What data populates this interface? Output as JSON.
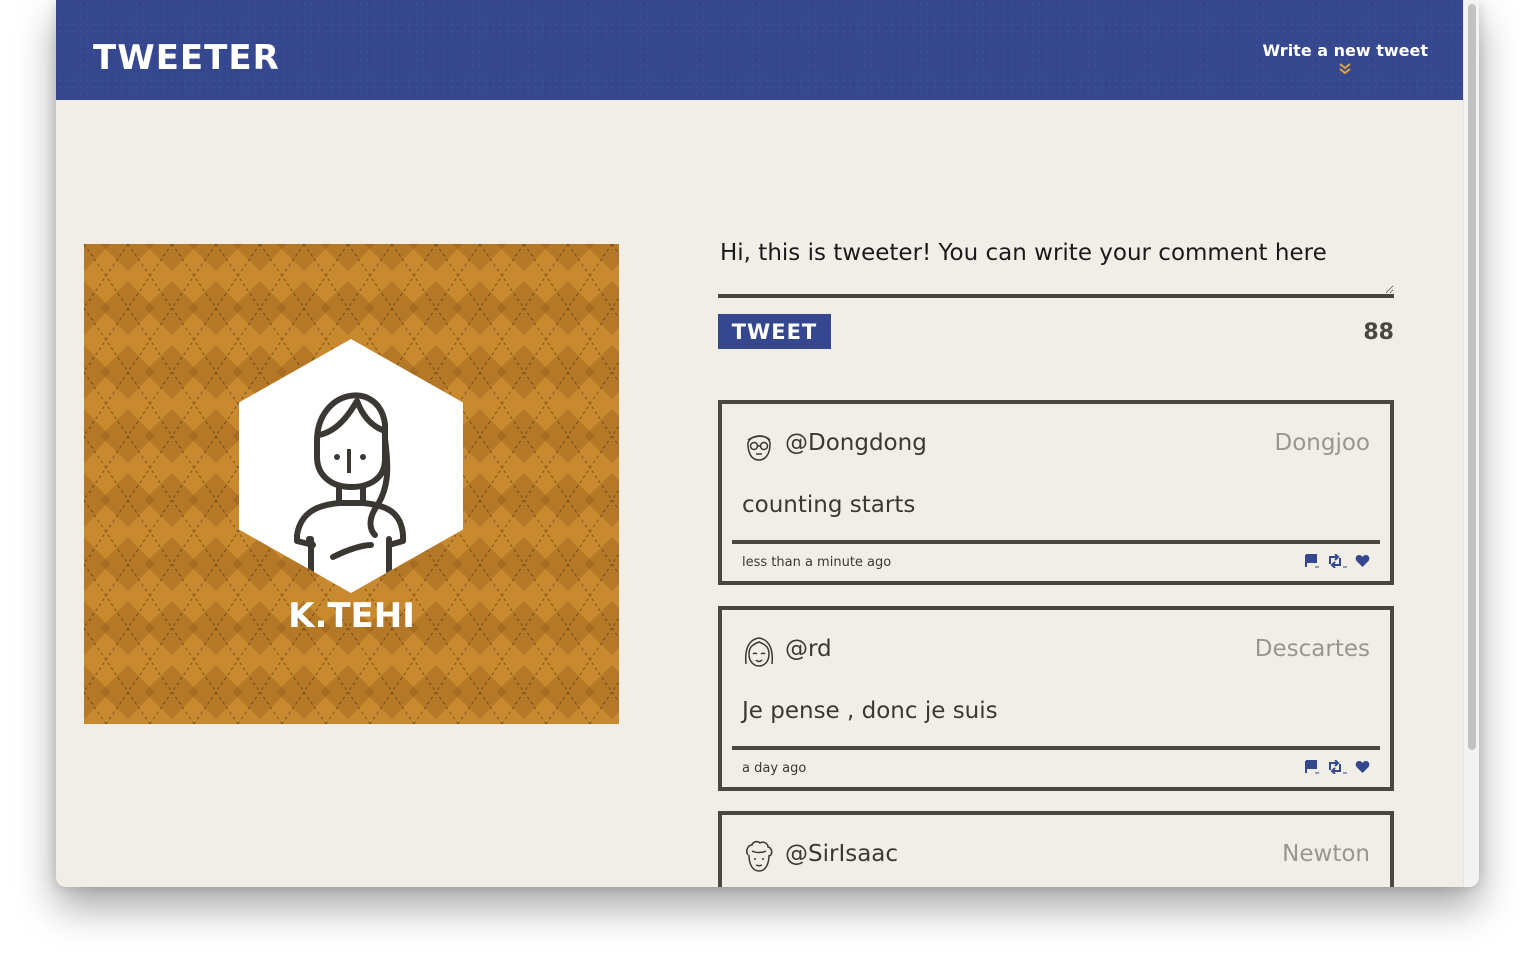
{
  "navbar": {
    "brand": "TWEETER",
    "compose_link": "Write a new tweet",
    "compose_arrow": "»"
  },
  "profile": {
    "name": "K.TEHI"
  },
  "compose": {
    "text": "Hi, this is tweeter! You can write your comment here",
    "button_label": "TWEET",
    "counter": "88"
  },
  "tweets": [
    {
      "handle": "@Dongdong",
      "name": "Dongjoo",
      "content": "counting starts",
      "time": "less than a minute ago",
      "avatar_icon": "avatar-glasses-icon"
    },
    {
      "handle": "@rd",
      "name": "Descartes",
      "content": "Je pense , donc je suis",
      "time": "a day ago",
      "avatar_icon": "avatar-smile-icon"
    },
    {
      "handle": "@SirIsaac",
      "name": "Newton",
      "content": "",
      "time": "",
      "avatar_icon": "avatar-curly-icon"
    }
  ],
  "colors": {
    "primary": "#35488f",
    "accent": "#e3a33a",
    "background": "#f1eee8",
    "border": "#4a4640",
    "profile_bg": "#c98a2f"
  }
}
